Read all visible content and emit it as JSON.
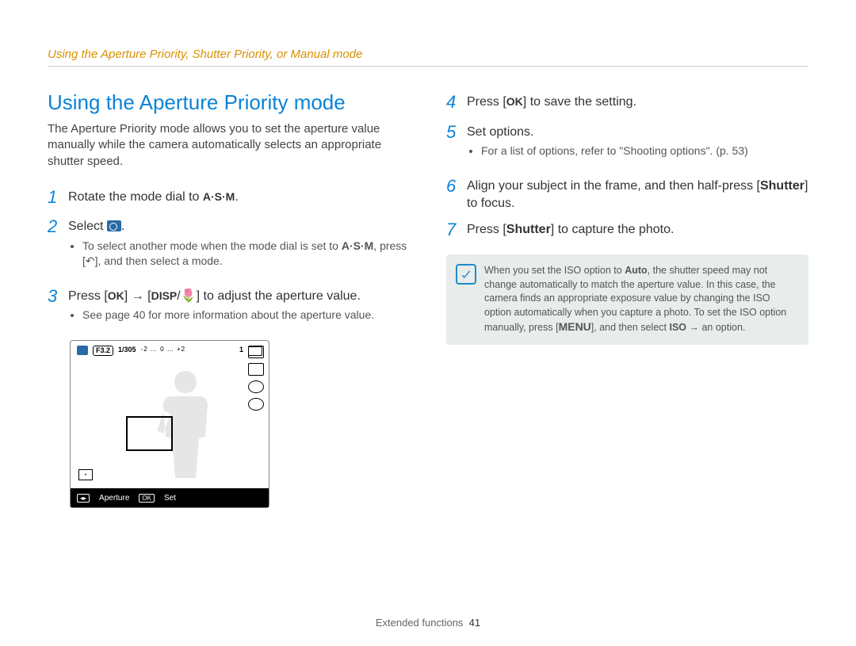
{
  "breadcrumb": "Using the Aperture Priority, Shutter Priority, or Manual mode",
  "heading": "Using the Aperture Priority mode",
  "intro": "The Aperture Priority mode allows you to set the aperture value manually while the camera automatically selects an appropriate shutter speed.",
  "steps_left": [
    {
      "n": "1",
      "text_before": "Rotate the mode dial to ",
      "icon": "A·S·M",
      "text_after": "."
    },
    {
      "n": "2",
      "text": "Select ",
      "icon": "aperture-mode-icon",
      "trail": ".",
      "sub": [
        "To select another mode when the mode dial is set to A·S·M, press [ ↶ ], and then select a mode."
      ]
    },
    {
      "n": "3",
      "html": [
        "Press [",
        "OK",
        "] → [",
        "DISP",
        "/",
        "macro",
        "] to adjust the aperture value."
      ],
      "sub": [
        "See page 40 for more information about the aperture value."
      ]
    }
  ],
  "screenshot": {
    "fvalue": "F3.2",
    "shutter": "1/305",
    "ev_ticks": "-2 … 0 … +2",
    "count": "1",
    "bottom_left": "Aperture",
    "bottom_right": "Set",
    "bottom_btn": "OK"
  },
  "steps_right": [
    {
      "n": "4",
      "html": [
        "Press [",
        "OK",
        "] to save the setting."
      ]
    },
    {
      "n": "5",
      "text": "Set options.",
      "sub": [
        "For a list of options, refer to \"Shooting options\". (p. 53)"
      ]
    },
    {
      "n": "6",
      "html": [
        "Align your subject in the frame, and then half-press [",
        "Shutter",
        "] to focus."
      ]
    },
    {
      "n": "7",
      "html": [
        "Press [",
        "Shutter",
        "] to capture the photo."
      ]
    }
  ],
  "note": {
    "text_parts": [
      "When you set the ISO option to ",
      "Auto",
      ", the shutter speed may not change automatically to match the aperture value. In this case, the camera finds an appropriate exposure value by changing the ISO option automatically when you capture a photo. To set the ISO option manually, press [",
      "MENU",
      "], and then select ",
      "ISO",
      " → an option."
    ]
  },
  "footer": {
    "section": "Extended functions",
    "page": "41"
  }
}
